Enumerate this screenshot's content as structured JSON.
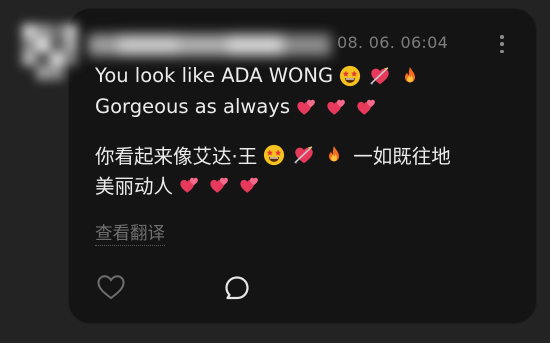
{
  "comment": {
    "timestamp": "08. 06. 06:04",
    "more_icon": "more-vertical-icon",
    "lines": [
      {
        "text": "You look like ADA WONG",
        "emojis": [
          "star-struck-emoji",
          "heart-with-arrow-emoji",
          "fire-emoji"
        ]
      },
      {
        "text": "Gorgeous as always",
        "emojis": [
          "two-hearts-emoji",
          "two-hearts-emoji",
          "two-hearts-emoji"
        ]
      }
    ],
    "chinese_line1": {
      "before": "你看起来像艾达·王",
      "emojis": [
        "star-struck-emoji",
        "heart-with-arrow-emoji",
        "fire-emoji"
      ],
      "after": "一如既往地"
    },
    "chinese_line2": {
      "text": "美丽动人",
      "emojis": [
        "two-hearts-emoji",
        "two-hearts-emoji",
        "two-hearts-emoji"
      ]
    },
    "translate_label": "查看翻译",
    "like_icon": "heart-outline-icon",
    "reply_icon": "speech-bubble-icon"
  },
  "colors": {
    "background": "#232323",
    "card": "#141414",
    "text": "#ececec",
    "muted": "#7d7d7d"
  }
}
